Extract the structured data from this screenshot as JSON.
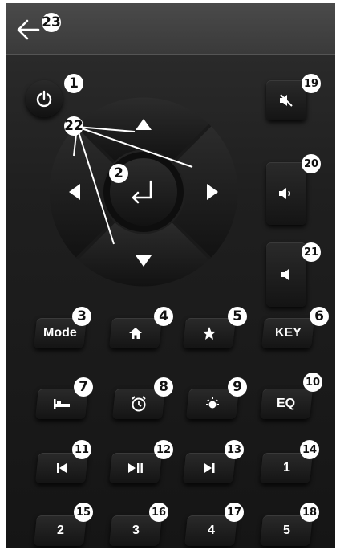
{
  "screen": {
    "background": "#1a1a1a",
    "accent": "#ffffff"
  },
  "header": {
    "back_icon": "arrow-left-icon",
    "badge": "23"
  },
  "power": {
    "icon": "power-icon",
    "badge": "1"
  },
  "dpad": {
    "center_icon": "enter-return-icon",
    "center_badge": "2",
    "arrows_badge": "22",
    "up_icon": "triangle-up-icon",
    "down_icon": "triangle-down-icon",
    "left_icon": "triangle-left-icon",
    "right_icon": "triangle-right-icon"
  },
  "volume": {
    "mute": {
      "icon": "mute-icon",
      "badge": "19"
    },
    "up": {
      "icon": "volume-up-icon",
      "badge": "20"
    },
    "down": {
      "icon": "volume-down-icon",
      "badge": "21"
    }
  },
  "row1": [
    {
      "label": "Mode",
      "badge": "3"
    },
    {
      "icon": "home-icon",
      "badge": "4"
    },
    {
      "icon": "star-icon",
      "badge": "5"
    },
    {
      "label": "KEY",
      "badge": "6"
    }
  ],
  "row2": [
    {
      "icon": "sleep-bed-icon",
      "badge": "7"
    },
    {
      "icon": "alarm-clock-icon",
      "badge": "8"
    },
    {
      "icon": "brightness-icon",
      "badge": "9"
    },
    {
      "label": "EQ",
      "badge": "10"
    }
  ],
  "row3": [
    {
      "icon": "previous-track-icon",
      "badge": "11"
    },
    {
      "icon": "play-pause-icon",
      "badge": "12"
    },
    {
      "icon": "next-track-icon",
      "badge": "13"
    },
    {
      "label": "1",
      "badge": "14"
    }
  ],
  "row4": [
    {
      "label": "2",
      "badge": "15"
    },
    {
      "label": "3",
      "badge": "16"
    },
    {
      "label": "4",
      "badge": "17"
    },
    {
      "label": "5",
      "badge": "18"
    }
  ]
}
